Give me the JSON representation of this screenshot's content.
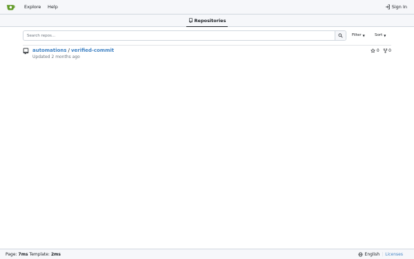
{
  "navbar": {
    "logo_icon": "gitea-logo-icon",
    "brand_color": "#609926",
    "explore_label": "Explore",
    "help_label": "Help",
    "signin_label": "Sign In",
    "signin_icon": "sign-in-icon"
  },
  "tabs": {
    "active_label": "Repositories",
    "active_icon": "repo-icon"
  },
  "search": {
    "placeholder": "Search repos...",
    "button_icon": "search-icon",
    "filter_label": "Filter",
    "sort_label": "Sort"
  },
  "repos": [
    {
      "owner": "automations",
      "separator": "/",
      "name": "verified-commit",
      "updated_prefix": "Updated",
      "updated_time": "2 months ago",
      "stars": "0",
      "forks": "0"
    }
  ],
  "footer": {
    "page_label": "Page:",
    "page_time": "7ms",
    "template_label": "Template:",
    "template_time": "2ms",
    "language": "English",
    "separator": "|",
    "licenses_label": "Licenses"
  },
  "colors": {
    "link": "#4183c4",
    "background": "#f6f7fa",
    "border": "#d0d7de"
  }
}
